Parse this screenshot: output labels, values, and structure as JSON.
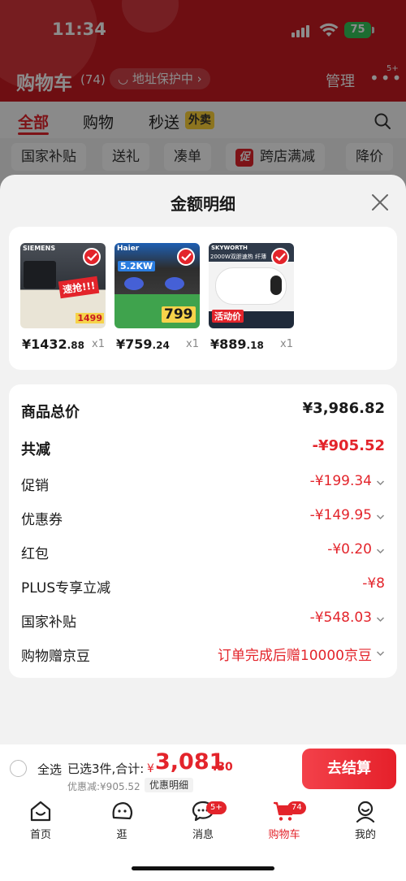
{
  "status": {
    "time": "11:34",
    "battery": "75"
  },
  "header": {
    "title": "购物车",
    "count": "(74)",
    "address": "地址保护中",
    "manage": "管理",
    "more_badge": "5+"
  },
  "tabs": [
    {
      "label": "全部"
    },
    {
      "label": "购物"
    },
    {
      "label": "秒送"
    }
  ],
  "waimai": "外卖",
  "filters": [
    "国家补贴",
    "送礼",
    "凑单",
    "跨店满减",
    "降价"
  ],
  "cu_badge": "促",
  "sheet": {
    "title": "金额明细",
    "products": [
      {
        "price_main": "¥1432",
        "price_dec": ".88",
        "qty": "x1",
        "thumb_brand": "SIEMENS",
        "thumb_text": "速抢!!!",
        "thumb_price": "1499"
      },
      {
        "price_main": "¥759",
        "price_dec": ".24",
        "qty": "x1",
        "thumb_brand": "Haier",
        "thumb_text": "5.2KW",
        "thumb_price": "799"
      },
      {
        "price_main": "¥889",
        "price_dec": ".18",
        "qty": "x1",
        "thumb_brand": "SKYWORTH",
        "thumb_text": "活动价",
        "thumb_price": "2000W双胆速热 纤薄"
      }
    ],
    "rows": [
      {
        "label": "商品总价",
        "value": "¥3,986.82"
      },
      {
        "label": "共减",
        "value": "-¥905.52"
      },
      {
        "label": "促销",
        "value": "-¥199.34"
      },
      {
        "label": "优惠券",
        "value": "-¥149.95"
      },
      {
        "label": "红包",
        "value": "-¥0.20"
      },
      {
        "label": "PLUS专享立减",
        "value": "-¥8"
      },
      {
        "label": "国家补贴",
        "value": "-¥548.03"
      },
      {
        "label": "购物赠京豆",
        "value": "订单完成后赠10000京豆"
      }
    ]
  },
  "checkout": {
    "select_all": "全选",
    "selected_info": "已选3件,合计:",
    "currency": "¥",
    "total_int": "3,081",
    "total_dec": ".30",
    "discount": "优惠减:¥905.52",
    "detail_tag": "优惠明细",
    "button": "去结算"
  },
  "tabbar": [
    {
      "label": "首页"
    },
    {
      "label": "逛"
    },
    {
      "label": "消息",
      "badge": "5+"
    },
    {
      "label": "购物车",
      "badge": "74"
    },
    {
      "label": "我的"
    }
  ],
  "colors": {
    "brand_red": "#e3242b",
    "header_red": "#c81a22",
    "battery_green": "#34c759"
  }
}
